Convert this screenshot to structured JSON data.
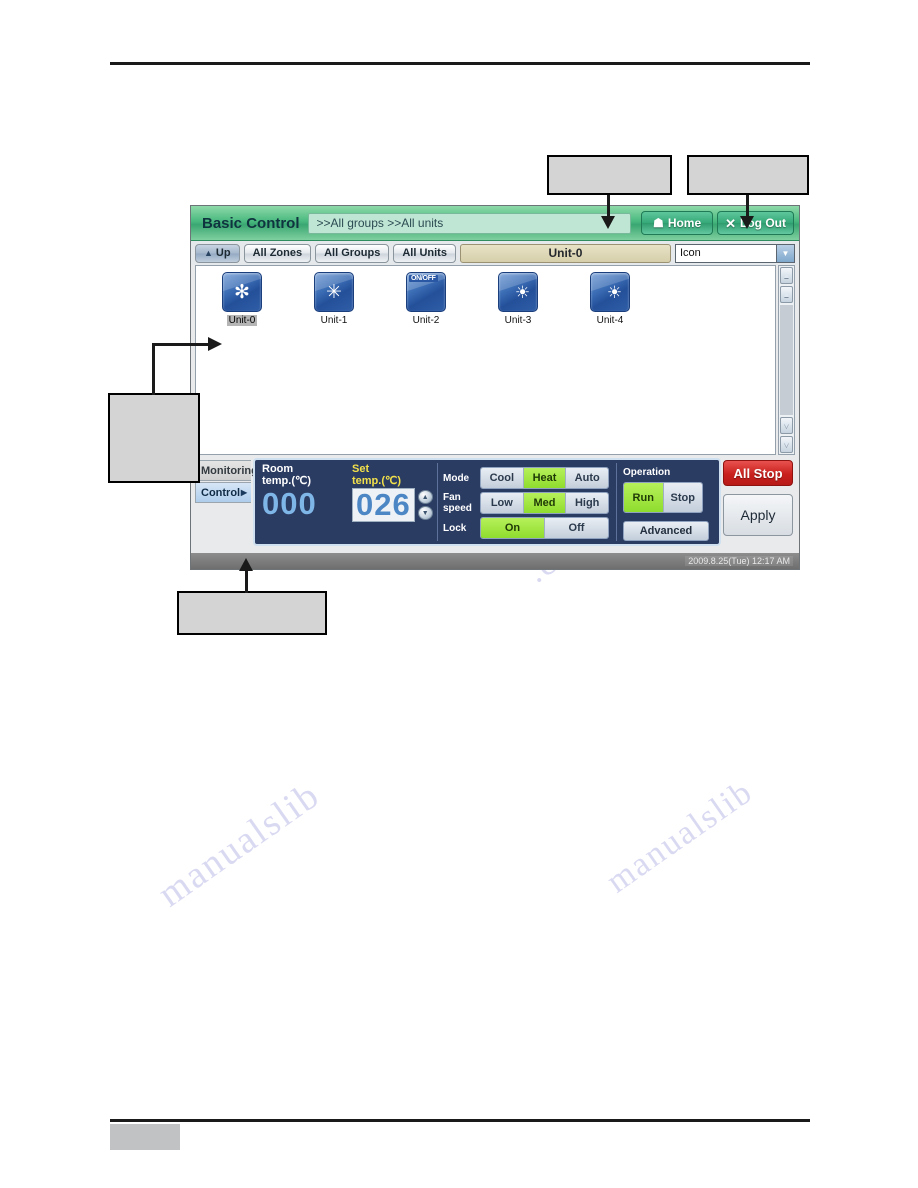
{
  "watermark": {
    "line1": "manualslib",
    "line2": ".com",
    "line3": "manualslib"
  },
  "callouts": {
    "top_left": "",
    "top_right": "",
    "left": "",
    "bottom": ""
  },
  "app": {
    "header": {
      "title": "Basic Control",
      "breadcrumb": ">>All groups >>All units",
      "home_label": "Home",
      "home_icon": "home-icon",
      "logout_label": "Log Out",
      "logout_icon": "x-icon"
    },
    "toolbar": {
      "up_label": "Up",
      "up_icon": "arrow-up-icon",
      "all_zones_label": "All Zones",
      "all_groups_label": "All Groups",
      "all_units_label": "All Units",
      "selected_unit": "Unit-0",
      "view_mode": "Icon",
      "view_mode_icon": "chevron-down-icon"
    },
    "units": [
      {
        "label": "Unit-0",
        "icon": "snowflake-icon",
        "glyph": "✻",
        "selected": true,
        "tag": ""
      },
      {
        "label": "Unit-1",
        "icon": "fan-icon",
        "glyph": "✳",
        "selected": false,
        "tag": ""
      },
      {
        "label": "Unit-2",
        "icon": "onoff-icon",
        "glyph": "",
        "selected": false,
        "tag": "ON/OFF"
      },
      {
        "label": "Unit-3",
        "icon": "sun-icon",
        "glyph": "☀",
        "selected": false,
        "tag": ""
      },
      {
        "label": "Unit-4",
        "icon": "sun-icon",
        "glyph": "☀",
        "selected": false,
        "tag": ""
      }
    ],
    "scrollbar": {
      "top_double_icon": "double-chevron-up-icon",
      "top_single_icon": "chevron-up-icon",
      "bottom_single_icon": "chevron-down-icon",
      "bottom_double_icon": "double-chevron-down-icon",
      "top_double_glyph": "▲",
      "top_single_glyph": "▲",
      "bottom_single_glyph": "▼",
      "bottom_double_glyph": "▼"
    },
    "side_tabs": [
      {
        "label": "Monitoring",
        "active": false
      },
      {
        "label": "Control",
        "active": true,
        "caret": "▶"
      }
    ],
    "control_panel": {
      "room_temp_label_1": "Room",
      "room_temp_label_2": "temp.(℃)",
      "room_temp_value": "000",
      "set_temp_label_1": "Set",
      "set_temp_label_2": "temp.(℃)",
      "set_temp_value": "026",
      "spinner_up_icon": "spinner-up-icon",
      "spinner_down_icon": "spinner-down-icon",
      "spinner_up_glyph": "▲",
      "spinner_down_glyph": "▼",
      "mode_label": "Mode",
      "mode_options": [
        "Cool",
        "Heat",
        "Auto"
      ],
      "mode_selected": "Heat",
      "fan_label_1": "Fan",
      "fan_label_2": "speed",
      "fan_options": [
        "Low",
        "Med",
        "High"
      ],
      "fan_selected": "Med",
      "lock_label": "Lock",
      "lock_options": [
        "On",
        "Off"
      ],
      "lock_selected": "On",
      "operation_label": "Operation",
      "operation_options": [
        "Run",
        "Stop"
      ],
      "operation_selected": "Run",
      "advanced_label": "Advanced"
    },
    "actions": {
      "all_stop_label": "All Stop",
      "apply_label": "Apply"
    },
    "status": {
      "datetime": "2009.8.25(Tue)  12:17 AM"
    }
  },
  "colors": {
    "header_green": "#3aa772",
    "panel_navy": "#2b3c63",
    "active_green": "#8fdd2e",
    "all_stop_red": "#c9201d",
    "unit_field_tan": "#d7cfab",
    "set_temp_yellow": "#f2e04a",
    "big_num_blue": "#7fb6e8"
  }
}
